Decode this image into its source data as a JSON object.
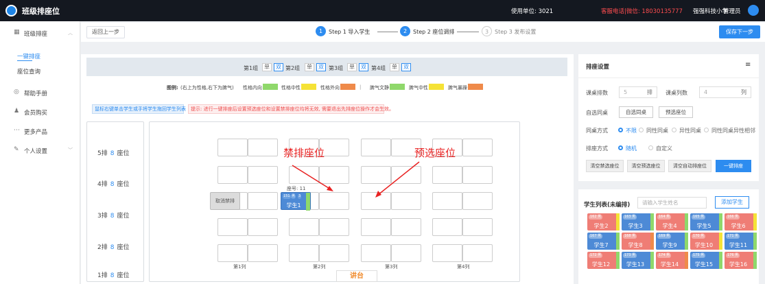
{
  "app": {
    "title": "班级排座位"
  },
  "topbar": {
    "unit": "使用单位: 3021",
    "contact": "客服电话|微信: 18030135777",
    "school": "强强科技小学",
    "role": "管理员"
  },
  "sidebar": {
    "items": [
      {
        "icon": "grid-icon",
        "label": "班级排座",
        "chevron": "^"
      },
      {
        "icon": "help-icon",
        "label": "帮助手册"
      },
      {
        "icon": "user-icon",
        "label": "会员购买"
      },
      {
        "icon": "more-icon",
        "label": "更多产品"
      },
      {
        "icon": "edit-icon",
        "label": "个人设置",
        "chevron": "v"
      }
    ],
    "subitems": [
      {
        "label": "一键排座",
        "active": true
      },
      {
        "label": "座位查询",
        "active": false
      }
    ]
  },
  "steps": {
    "back_label": "返回上一步",
    "save_label": "保存下一步",
    "items": [
      {
        "num": "1",
        "label": "Step 1 导入学生"
      },
      {
        "num": "2",
        "label": "Step 2 座位调排"
      },
      {
        "num": "3",
        "label": "Step 3 发布设置"
      }
    ]
  },
  "groups": [
    {
      "label": "第1组",
      "single": "单",
      "double": "双"
    },
    {
      "label": "第2组",
      "single": "单",
      "double": "双"
    },
    {
      "label": "第3组",
      "single": "单",
      "double": "双"
    },
    {
      "label": "第4组",
      "single": "单",
      "double": "双"
    }
  ],
  "legend": {
    "title": "图例:",
    "subtitle": "(右上为性格,右下为脾气)",
    "items": [
      {
        "label": "性格内向",
        "color": "#8fd86b"
      },
      {
        "label": "性格中性",
        "color": "#f5e236"
      },
      {
        "label": "性格外向",
        "color": "#ef8a4a"
      },
      {
        "label": "脾气文静",
        "color": "#8fd86b"
      },
      {
        "label": "脾气中性",
        "color": "#f5e236"
      },
      {
        "label": "脾气暴躁",
        "color": "#ef8a4a"
      }
    ],
    "divider": "|"
  },
  "hints": {
    "blue": "鼠标右键单击学生或手将学生拖回学生列表",
    "red": "提示: 进行一键排座后设置预选座位和设置禁排座位均将无效, 需要退出先排座位操作才会生效。"
  },
  "rows": [
    {
      "label": "5排",
      "n": "8",
      "suffix": "座位"
    },
    {
      "label": "4排",
      "n": "8",
      "suffix": "座位"
    },
    {
      "label": "3排",
      "n": "8",
      "suffix": "座位"
    },
    {
      "label": "2排",
      "n": "8",
      "suffix": "座位"
    },
    {
      "label": "1排",
      "n": "8",
      "suffix": "座位"
    }
  ],
  "seating": {
    "columns": [
      "第1列",
      "第2列",
      "第3列",
      "第4列"
    ],
    "podium": "讲台",
    "banned_seat_label": "取消禁排",
    "preselect_seat_no": "座号: 11",
    "preselect_student": "学生1",
    "preselect_tags": [
      "151",
      "男",
      "3"
    ],
    "annot_banned": "禁排座位",
    "annot_preselect": "预选座位"
  },
  "settings": {
    "title": "排座设置",
    "menu_icon": "≡",
    "rows_label": "课桌排数",
    "rows_value": "5",
    "rows_unit": "排",
    "cols_label": "课桌列数",
    "cols_value": "4",
    "cols_unit": "列",
    "select_label": "自选同桌",
    "select_btn1": "自选同桌",
    "select_btn2": "预选座位",
    "desk_label": "同桌方式",
    "desk_options": [
      "不限",
      "同性同桌",
      "异性同桌",
      "同性同桌异性相邻"
    ],
    "method_label": "排座方式",
    "method_options": [
      "随机",
      "自定义"
    ],
    "actions": [
      "清空禁选座位",
      "清空预选座位",
      "清空自动排座位",
      "一键排座"
    ]
  },
  "students": {
    "title": "学生列表(未编排)",
    "search_placeholder": "请输入学生姓名",
    "add_label": "添加学生",
    "cards": [
      {
        "name": "学生2",
        "tag": "162 男",
        "color": "#ef7d75",
        "side": "#f5e236"
      },
      {
        "name": "学生3",
        "tag": "163 男",
        "color": "#4d8ad6",
        "side": "#8fd86b"
      },
      {
        "name": "学生4",
        "tag": "164 男",
        "color": "#ef7d75",
        "side": "#8fd86b"
      },
      {
        "name": "学生5",
        "tag": "165 男",
        "color": "#4d8ad6",
        "side": "#8fd86b"
      },
      {
        "name": "学生6",
        "tag": "166 男",
        "color": "#ef7d75",
        "side": "#f5e236"
      },
      {
        "name": "学生7",
        "tag": "167 男",
        "color": "#4d8ad6",
        "side": "#8fd86b"
      },
      {
        "name": "学生8",
        "tag": "168 男",
        "color": "#ef7d75",
        "side": "#ef8a4a"
      },
      {
        "name": "学生9",
        "tag": "169 男",
        "color": "#4d8ad6",
        "side": "#8fd86b"
      },
      {
        "name": "学生10",
        "tag": "170 男",
        "color": "#ef7d75",
        "side": "#f5e236"
      },
      {
        "name": "学生11",
        "tag": "171 男",
        "color": "#4d8ad6",
        "side": "#8fd86b"
      },
      {
        "name": "学生12",
        "tag": "172 男",
        "color": "#ef7d75",
        "side": "#8fd86b"
      },
      {
        "name": "学生13",
        "tag": "173 男",
        "color": "#4d8ad6",
        "side": "#8fd86b"
      },
      {
        "name": "学生14",
        "tag": "174 男",
        "color": "#ef7d75",
        "side": "#ef8a4a"
      },
      {
        "name": "学生15",
        "tag": "175 男",
        "color": "#4d8ad6",
        "side": "#8fd86b"
      },
      {
        "name": "学生16",
        "tag": "176 男",
        "color": "#ef7d75",
        "side": "#8fd86b"
      }
    ]
  },
  "colors": {
    "accent": "#2d8cf0",
    "topbar": "#141820",
    "annotation": "#e92222",
    "podium": "#f08c2e"
  }
}
